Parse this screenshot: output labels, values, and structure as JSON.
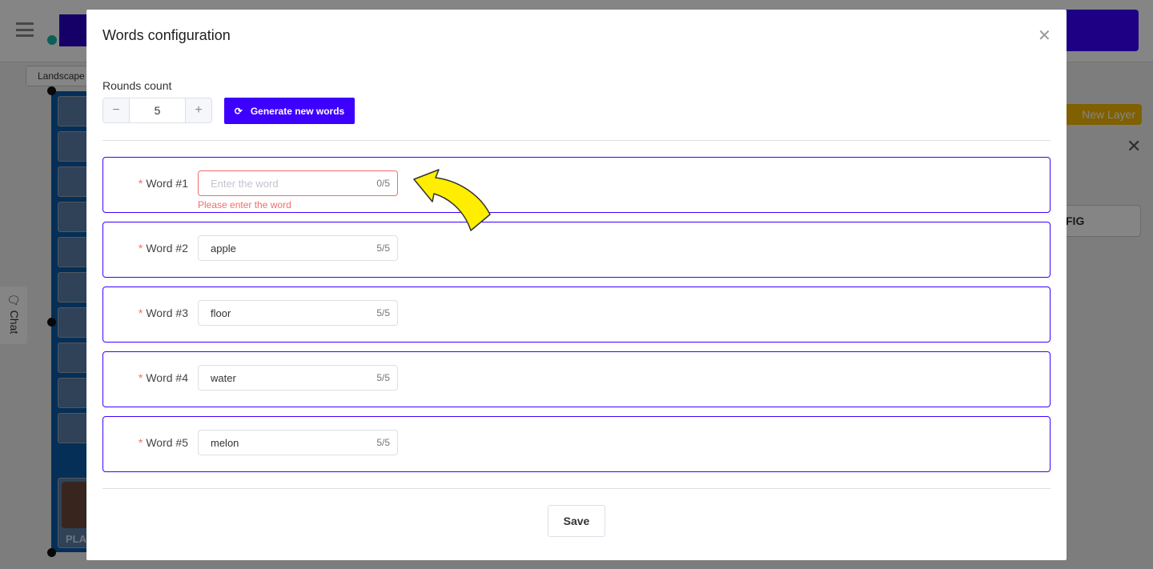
{
  "background": {
    "landscape_label": "Landscape",
    "chat_label": "Chat",
    "new_layer_label": "New Layer",
    "config_label": "FIG",
    "player_label": "PLA"
  },
  "modal": {
    "title": "Words configuration",
    "rounds_label": "Rounds count",
    "rounds_value": "5",
    "generate_label": "Generate new words",
    "words": [
      {
        "label": "Word #1",
        "value": "",
        "placeholder": "Enter the word",
        "count": "0/5",
        "error": "Please enter the word"
      },
      {
        "label": "Word #2",
        "value": "apple",
        "count": "5/5"
      },
      {
        "label": "Word #3",
        "value": "floor",
        "count": "5/5"
      },
      {
        "label": "Word #4",
        "value": "water",
        "count": "5/5"
      },
      {
        "label": "Word #5",
        "value": "melon",
        "count": "5/5"
      }
    ],
    "save_label": "Save"
  },
  "colors": {
    "accent": "#3d00ff",
    "error": "#f56c6c",
    "annotation_arrow": "#ffee00"
  }
}
